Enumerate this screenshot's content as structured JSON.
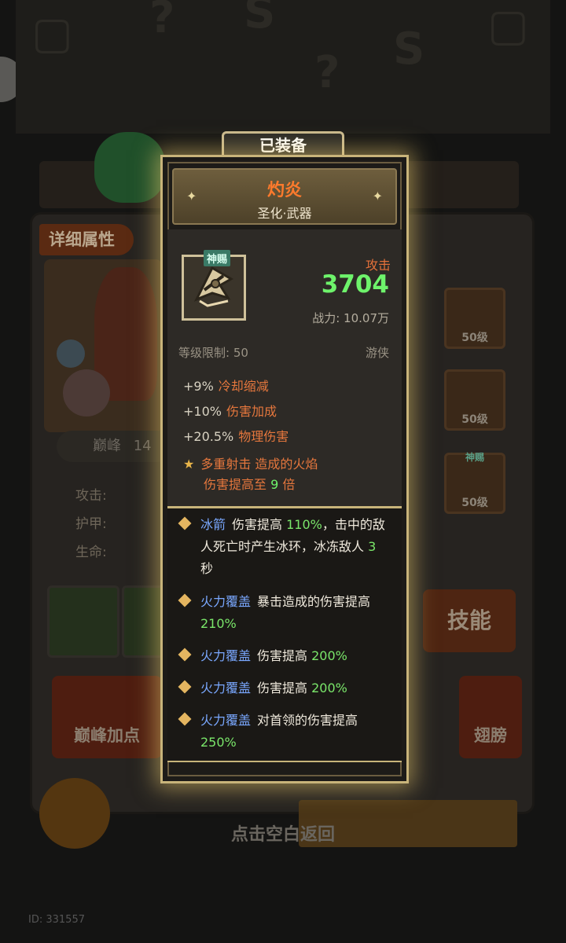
{
  "background": {
    "detail_tag": "详细属性",
    "peak_label": "巅峰",
    "peak_value": "14",
    "stats": [
      "攻击:",
      "护甲:",
      "生命:"
    ],
    "skill_button": "技能",
    "peak_points_button": "巅峰加点",
    "wings_button": "翅膀",
    "slots": [
      {
        "level": "50级",
        "tag": ""
      },
      {
        "level": "50级",
        "tag": ""
      },
      {
        "level": "50级",
        "tag": "神赐"
      }
    ],
    "hint": "点击空白返回",
    "id_text": "ID: 331557"
  },
  "popup": {
    "title": "已装备",
    "weapon_name": "灼炎",
    "weapon_type": "圣化·武器",
    "divine_tag": "神赐",
    "attr_label": "攻击",
    "attr_value": "3704",
    "power": "战力: 10.07万",
    "level_limit": "等级限制: 50",
    "class_name": "游侠",
    "stats": [
      {
        "value": "+9%",
        "desc": "冷却缩减"
      },
      {
        "value": "+10%",
        "desc": "伤害加成"
      },
      {
        "value": "+20.5%",
        "desc": "物理伤害"
      }
    ],
    "special": {
      "line1": "多重射击 造成的火焰",
      "line2_prefix": "伤害提高至",
      "line2_num": "9",
      "line2_suffix": "倍"
    },
    "skills": [
      {
        "name": "冰箭",
        "pre": "伤害提高",
        "pct": "110%",
        "post": "，击中的敌人死亡时产生冰环，冰冻敌人",
        "num": "3",
        "tail": "秒"
      },
      {
        "name": "火力覆盖",
        "pre": "暴击造成的伤害提高",
        "pct": "210%",
        "post": "",
        "num": "",
        "tail": ""
      },
      {
        "name": "火力覆盖",
        "pre": "伤害提高",
        "pct": "200%",
        "post": "",
        "num": "",
        "tail": ""
      },
      {
        "name": "火力覆盖",
        "pre": "伤害提高",
        "pct": "200%",
        "post": "",
        "num": "",
        "tail": ""
      },
      {
        "name": "火力覆盖",
        "pre": "对首领的伤害提高",
        "pct": "250%",
        "post": "",
        "num": "",
        "tail": ""
      }
    ]
  },
  "colors": {
    "gold_border": "#c8b47a",
    "attack_orange": "#e5713a",
    "value_green": "#6ef36b",
    "skill_blue": "#7aa8ff"
  }
}
